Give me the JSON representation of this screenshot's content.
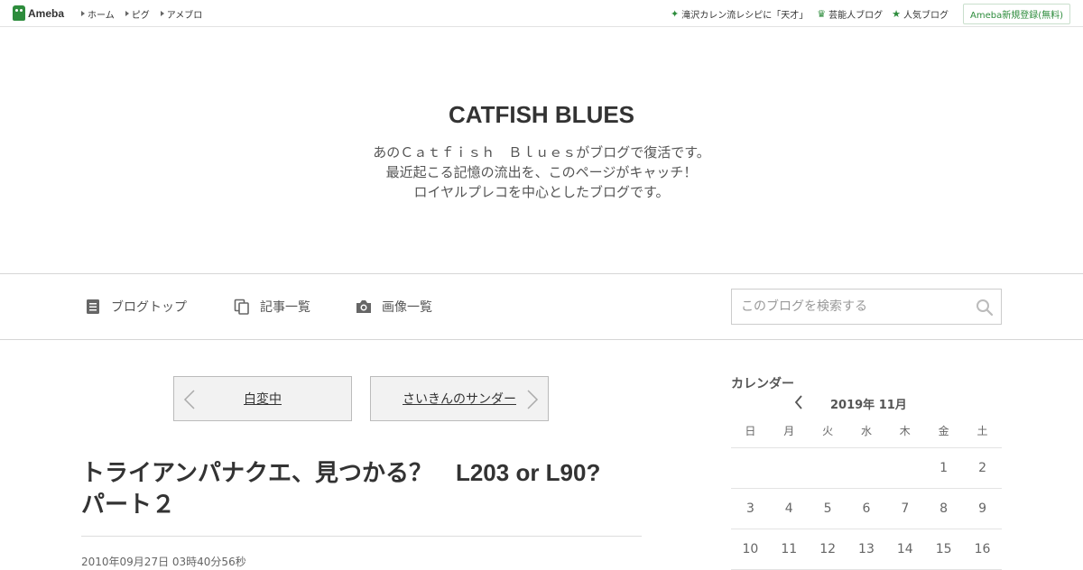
{
  "topbar": {
    "logo_text": "Ameba",
    "nav": [
      "ホーム",
      "ピグ",
      "アメブロ"
    ],
    "right_links": [
      {
        "icon": "sparkle-icon",
        "label": "滝沢カレン流レシピに「天才」"
      },
      {
        "icon": "crown-icon",
        "label": "芸能人ブログ"
      },
      {
        "icon": "star-icon",
        "label": "人気ブログ"
      }
    ],
    "register_label": "Ameba新規登録(無料)"
  },
  "header": {
    "title": "CATFISH BLUES",
    "description": [
      "あのＣａｔｆｉｓｈ　Ｂｌｕｅｓがブログで復活です。",
      "最近起こる記憶の流出を、このページがキャッチ！",
      "ロイヤルプレコを中心としたブログです。"
    ]
  },
  "nav": {
    "items": [
      {
        "icon": "document-icon",
        "label": "ブログトップ"
      },
      {
        "icon": "copy-icon",
        "label": "記事一覧"
      },
      {
        "icon": "camera-icon",
        "label": "画像一覧"
      }
    ],
    "search_placeholder": "このブログを検索する"
  },
  "pager": {
    "prev_label": "白変中",
    "next_label": "さいきんのサンダー"
  },
  "article": {
    "title_line1": "トライアンパナクエ、見つかる？　L203 or L90?",
    "title_line2": "パート２",
    "date": "2010年09月27日 03時40分56秒"
  },
  "calendar": {
    "heading": "カレンダー",
    "month_label": "2019年 11月",
    "weekdays": [
      "日",
      "月",
      "火",
      "水",
      "木",
      "金",
      "土"
    ],
    "weeks": [
      [
        "",
        "",
        "",
        "",
        "",
        "1",
        "2"
      ],
      [
        "3",
        "4",
        "5",
        "6",
        "7",
        "8",
        "9"
      ],
      [
        "10",
        "11",
        "12",
        "13",
        "14",
        "15",
        "16"
      ]
    ]
  },
  "colors": {
    "brand_green": "#2d8c3c",
    "border": "#d6d6d6"
  }
}
